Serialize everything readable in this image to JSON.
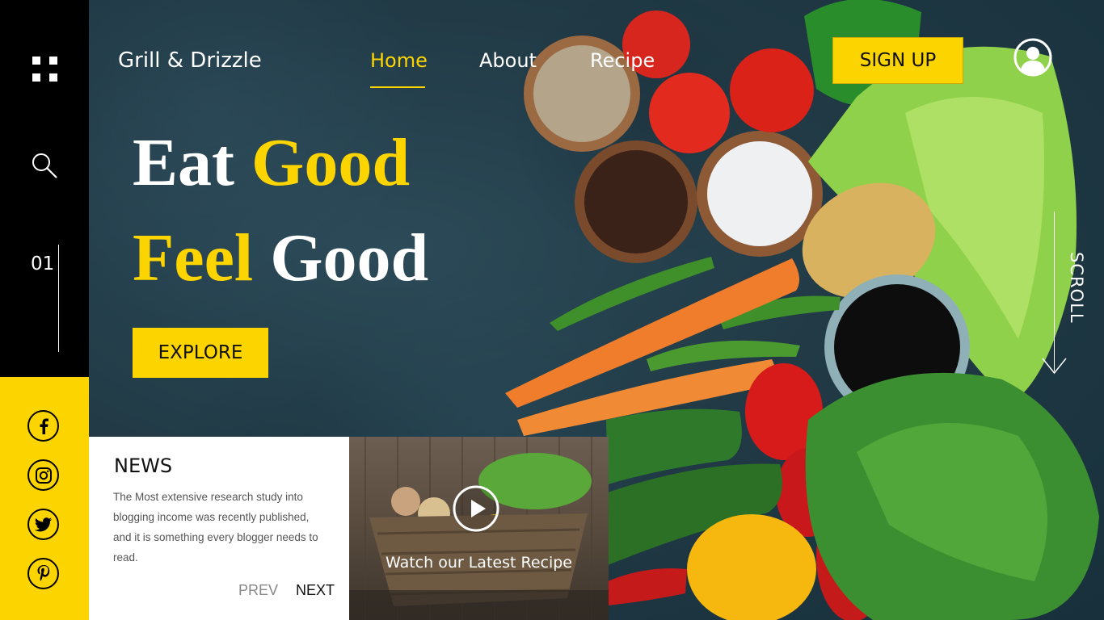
{
  "brand": "Grill & Drizzle",
  "nav": [
    {
      "label": "Home",
      "active": true
    },
    {
      "label": "About",
      "active": false
    },
    {
      "label": "Recipe",
      "active": false
    }
  ],
  "signup_label": "SIGN UP",
  "headline": {
    "line1": {
      "white": "Eat",
      "yellow": "Good"
    },
    "line2": {
      "yellow": "Feel",
      "white": "Good"
    }
  },
  "explore_label": "EXPLORE",
  "sidebar": {
    "slide_number": "01",
    "icons": [
      "menu-grid-icon",
      "search-icon"
    ],
    "social": [
      "facebook-icon",
      "instagram-icon",
      "twitter-icon",
      "pinterest-icon"
    ]
  },
  "scroll_label": "SCROLL",
  "news": {
    "title": "NEWS",
    "body": "The Most extensive research study into blogging income was recently published, and it is something every blogger needs to read.",
    "prev_label": "PREV",
    "next_label": "NEXT"
  },
  "video": {
    "caption": "Watch our Latest Recipe",
    "icon": "play-icon"
  },
  "colors": {
    "accent": "#fcd400",
    "sidebar": "#000000",
    "background": "#1f3440"
  }
}
